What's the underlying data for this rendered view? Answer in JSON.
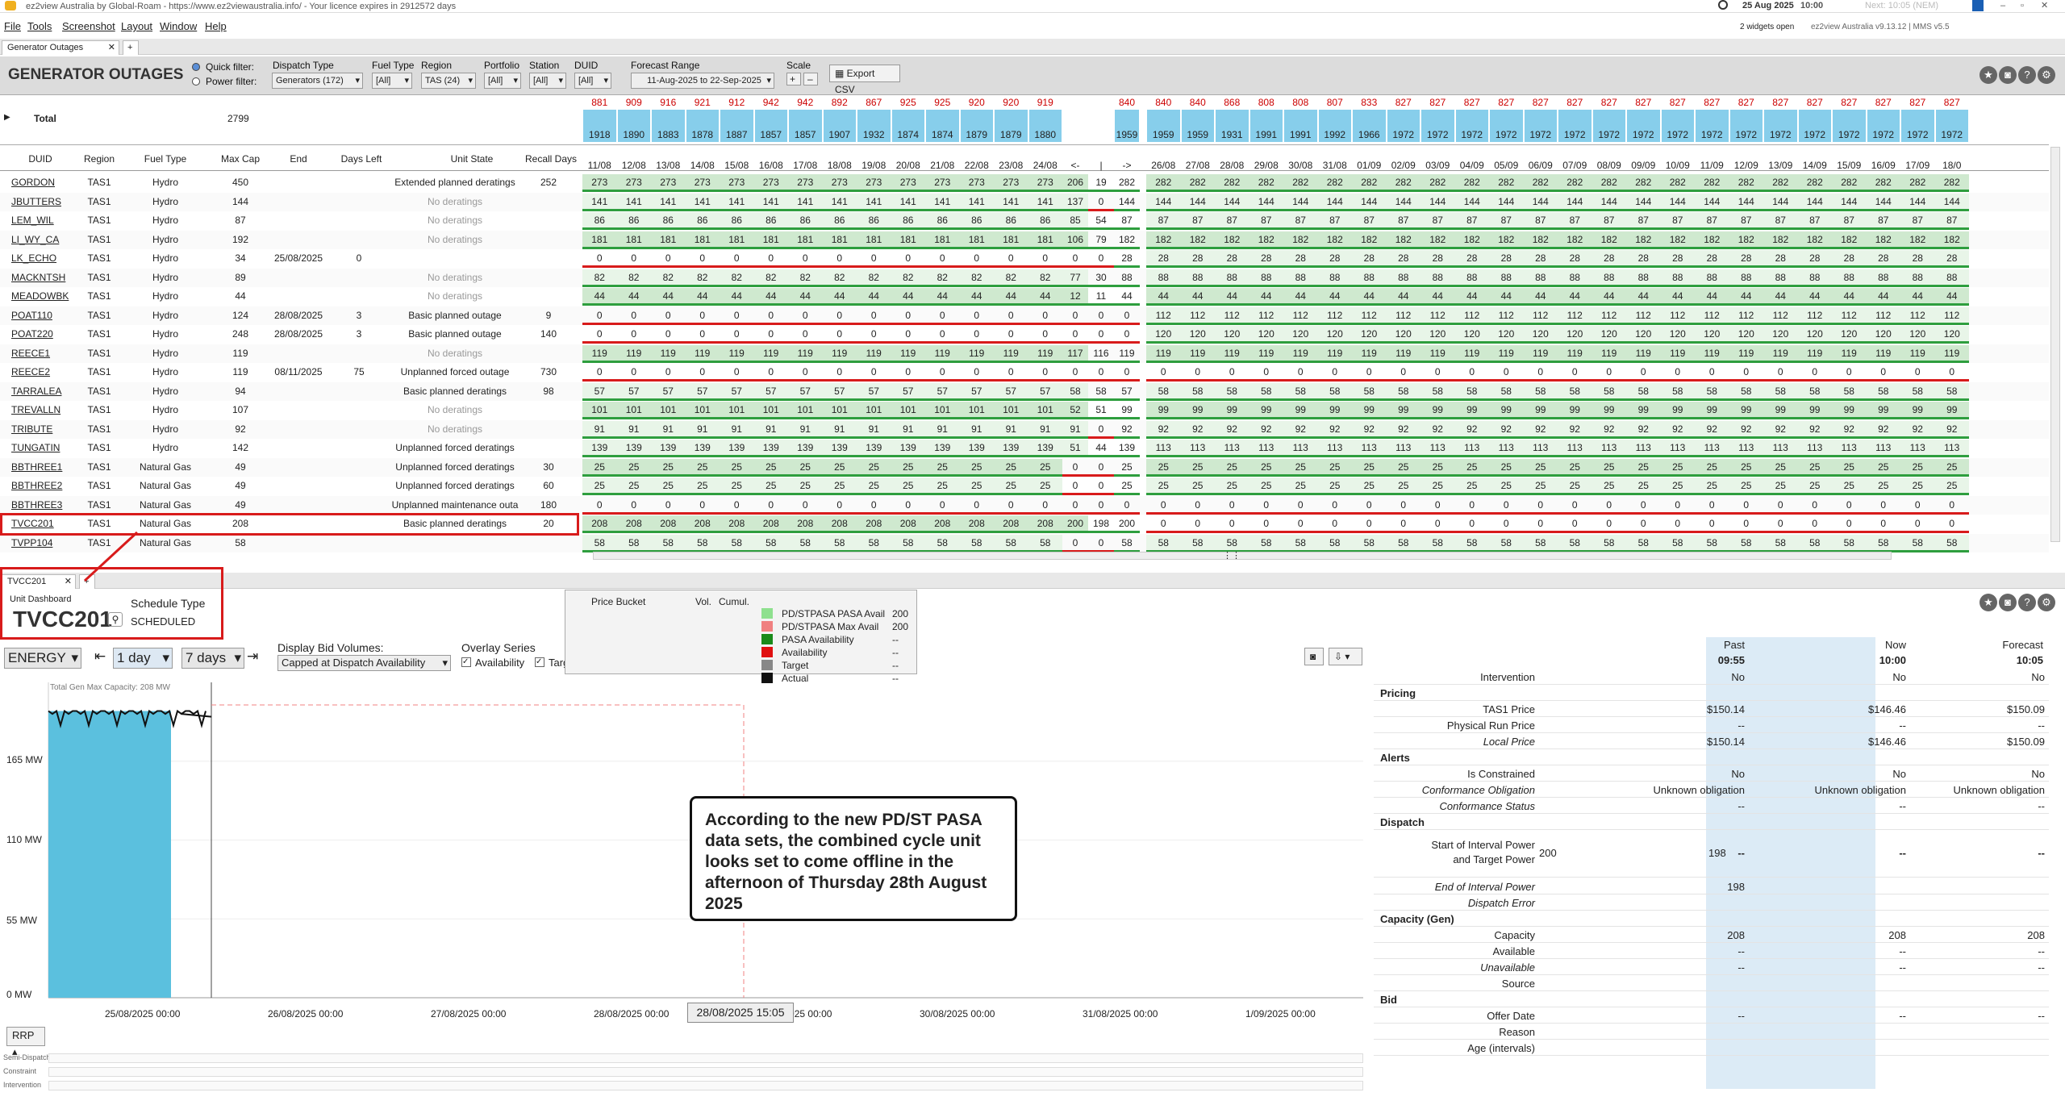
{
  "window": {
    "title": "ez2view Australia by Global-Roam - https://www.ez2viewaustralia.info/ - Your licence expires in 2912572 days",
    "date": "25 Aug 2025",
    "time": "10:00",
    "next": "Next: 10:05 (NEM)",
    "widgets_open": "2 widgets open",
    "version": "ez2view Australia v9.13.12 | MMS v5.5"
  },
  "menu": [
    "File",
    "Tools",
    "Screenshot",
    "Layout",
    "Window",
    "Help"
  ],
  "tabs": {
    "top": "Generator Outages",
    "add": "+",
    "lower": "TVCC201"
  },
  "toolbar": {
    "title": "GENERATOR OUTAGES",
    "quick_filter": "Quick filter:",
    "power_filter": "Power filter:",
    "dispatch_type_label": "Dispatch Type",
    "dispatch_type": "Generators (172)",
    "fuel_type_label": "Fuel Type",
    "fuel_type": "[All]",
    "region_label": "Region",
    "region": "TAS (24)",
    "portfolio_label": "Portfolio",
    "portfolio": "[All]",
    "station_label": "Station",
    "station": "[All]",
    "duid_label": "DUID",
    "duid": "[All]",
    "forecast_label": "Forecast Range",
    "forecast": "11-Aug-2025 to 22-Sep-2025",
    "scale_label": "Scale",
    "export": "Export CSV"
  },
  "total": {
    "label": "Total",
    "maxcap": "2799",
    "top": [
      "881",
      "909",
      "916",
      "921",
      "912",
      "942",
      "942",
      "892",
      "867",
      "925",
      "925",
      "920",
      "920",
      "919",
      "",
      "",
      "840",
      "840",
      "840",
      "868",
      "808",
      "808",
      "807",
      "833",
      "827",
      "827",
      "827",
      "827",
      "827",
      "827",
      "827",
      "827",
      "827",
      "827",
      "827",
      "827",
      "827",
      "827",
      "827",
      "827",
      "827",
      "827",
      "827"
    ],
    "bottom": [
      "1918",
      "1890",
      "1883",
      "1878",
      "1887",
      "1857",
      "1857",
      "1907",
      "1932",
      "1874",
      "1874",
      "1879",
      "1879",
      "1880",
      "",
      "",
      "1959",
      "1959",
      "1959",
      "1931",
      "1991",
      "1991",
      "1992",
      "1966",
      "1972",
      "1972",
      "1972",
      "1972",
      "1972",
      "1972",
      "1972",
      "1972",
      "1972",
      "1972",
      "1972",
      "1972",
      "1972",
      "1972",
      "1972",
      "1972",
      "1972",
      "1972",
      "1972"
    ]
  },
  "columns": {
    "duid": "DUID",
    "region": "Region",
    "fuel": "Fuel Type",
    "maxcap": "Max Cap",
    "end": "End",
    "daysleft": "Days Left",
    "state": "Unit State",
    "recall": "Recall Days"
  },
  "dates": [
    "11/08",
    "12/08",
    "13/08",
    "14/08",
    "15/08",
    "16/08",
    "17/08",
    "18/08",
    "19/08",
    "20/08",
    "21/08",
    "22/08",
    "23/08",
    "24/08",
    "<-",
    "|",
    "->",
    "26/08",
    "27/08",
    "28/08",
    "29/08",
    "30/08",
    "31/08",
    "01/09",
    "02/09",
    "03/09",
    "04/09",
    "05/09",
    "06/09",
    "07/09",
    "08/09",
    "09/09",
    "10/09",
    "11/09",
    "12/09",
    "13/09",
    "14/09",
    "15/09",
    "16/09",
    "17/09",
    "18/0"
  ],
  "rows": [
    {
      "duid": "GORDON",
      "region": "TAS1",
      "fuel": "Hydro",
      "maxcap": "450",
      "end": "",
      "daysleft": "",
      "state": "Extended planned deratings",
      "recall": "252",
      "past": "273",
      "mid": [
        "206",
        "19",
        "282"
      ],
      "fut": "282"
    },
    {
      "duid": "JBUTTERS",
      "region": "TAS1",
      "fuel": "Hydro",
      "maxcap": "144",
      "end": "",
      "daysleft": "",
      "state": "No deratings",
      "recall": "",
      "past": "141",
      "mid": [
        "137",
        "0",
        "144"
      ],
      "fut": "144"
    },
    {
      "duid": "LEM_WIL",
      "region": "TAS1",
      "fuel": "Hydro",
      "maxcap": "87",
      "end": "",
      "daysleft": "",
      "state": "No deratings",
      "recall": "",
      "past": "86",
      "mid": [
        "85",
        "54",
        "87"
      ],
      "fut": "87"
    },
    {
      "duid": "LI_WY_CA",
      "region": "TAS1",
      "fuel": "Hydro",
      "maxcap": "192",
      "end": "",
      "daysleft": "",
      "state": "No deratings",
      "recall": "",
      "past": "181",
      "mid": [
        "106",
        "79",
        "182"
      ],
      "fut": "182"
    },
    {
      "duid": "LK_ECHO",
      "region": "TAS1",
      "fuel": "Hydro",
      "maxcap": "34",
      "end": "25/08/2025",
      "daysleft": "0",
      "state": "",
      "recall": "",
      "past": "0",
      "mid": [
        "0",
        "0",
        "28"
      ],
      "fut": "28"
    },
    {
      "duid": "MACKNTSH",
      "region": "TAS1",
      "fuel": "Hydro",
      "maxcap": "89",
      "end": "",
      "daysleft": "",
      "state": "No deratings",
      "recall": "",
      "past": "82",
      "mid": [
        "77",
        "30",
        "88"
      ],
      "fut": "88"
    },
    {
      "duid": "MEADOWBK",
      "region": "TAS1",
      "fuel": "Hydro",
      "maxcap": "44",
      "end": "",
      "daysleft": "",
      "state": "No deratings",
      "recall": "",
      "past": "44",
      "mid": [
        "12",
        "11",
        "44"
      ],
      "fut": "44"
    },
    {
      "duid": "POAT110",
      "region": "TAS1",
      "fuel": "Hydro",
      "maxcap": "124",
      "end": "28/08/2025",
      "daysleft": "3",
      "state": "Basic planned outage",
      "recall": "9",
      "past": "0",
      "mid": [
        "0",
        "0",
        "0"
      ],
      "fut": "112"
    },
    {
      "duid": "POAT220",
      "region": "TAS1",
      "fuel": "Hydro",
      "maxcap": "248",
      "end": "28/08/2025",
      "daysleft": "3",
      "state": "Basic planned outage",
      "recall": "140",
      "past": "0",
      "mid": [
        "0",
        "0",
        "0"
      ],
      "fut": "120"
    },
    {
      "duid": "REECE1",
      "region": "TAS1",
      "fuel": "Hydro",
      "maxcap": "119",
      "end": "",
      "daysleft": "",
      "state": "No deratings",
      "recall": "",
      "past": "119",
      "mid": [
        "117",
        "116",
        "119"
      ],
      "fut": "119"
    },
    {
      "duid": "REECE2",
      "region": "TAS1",
      "fuel": "Hydro",
      "maxcap": "119",
      "end": "08/11/2025",
      "daysleft": "75",
      "state": "Unplanned forced outage",
      "recall": "730",
      "past": "0",
      "mid": [
        "0",
        "0",
        "0"
      ],
      "fut": "0"
    },
    {
      "duid": "TARRALEA",
      "region": "TAS1",
      "fuel": "Hydro",
      "maxcap": "94",
      "end": "",
      "daysleft": "",
      "state": "Basic planned deratings",
      "recall": "98",
      "past": "57",
      "mid": [
        "58",
        "58",
        "57"
      ],
      "fut": "58"
    },
    {
      "duid": "TREVALLN",
      "region": "TAS1",
      "fuel": "Hydro",
      "maxcap": "107",
      "end": "",
      "daysleft": "",
      "state": "No deratings",
      "recall": "",
      "past": "101",
      "mid": [
        "52",
        "51",
        "99"
      ],
      "fut": "99"
    },
    {
      "duid": "TRIBUTE",
      "region": "TAS1",
      "fuel": "Hydro",
      "maxcap": "92",
      "end": "",
      "daysleft": "",
      "state": "No deratings",
      "recall": "",
      "past": "91",
      "mid": [
        "91",
        "0",
        "92"
      ],
      "fut": "92"
    },
    {
      "duid": "TUNGATIN",
      "region": "TAS1",
      "fuel": "Hydro",
      "maxcap": "142",
      "end": "",
      "daysleft": "",
      "state": "Unplanned forced deratings",
      "recall": "",
      "past": "139",
      "mid": [
        "51",
        "44",
        "139"
      ],
      "fut": "113"
    },
    {
      "duid": "BBTHREE1",
      "region": "TAS1",
      "fuel": "Natural Gas",
      "maxcap": "49",
      "end": "",
      "daysleft": "",
      "state": "Unplanned forced deratings",
      "recall": "30",
      "past": "25",
      "mid": [
        "0",
        "0",
        "25"
      ],
      "fut": "25"
    },
    {
      "duid": "BBTHREE2",
      "region": "TAS1",
      "fuel": "Natural Gas",
      "maxcap": "49",
      "end": "",
      "daysleft": "",
      "state": "Unplanned forced deratings",
      "recall": "60",
      "past": "25",
      "mid": [
        "0",
        "0",
        "25"
      ],
      "fut": "25"
    },
    {
      "duid": "BBTHREE3",
      "region": "TAS1",
      "fuel": "Natural Gas",
      "maxcap": "49",
      "end": "",
      "daysleft": "",
      "state": "Unplanned maintenance outa",
      "recall": "180",
      "past": "0",
      "mid": [
        "0",
        "0",
        "0"
      ],
      "fut": "0"
    },
    {
      "duid": "TVCC201",
      "region": "TAS1",
      "fuel": "Natural Gas",
      "maxcap": "208",
      "end": "",
      "daysleft": "",
      "state": "Basic planned deratings",
      "recall": "20",
      "past": "208",
      "mid": [
        "200",
        "198",
        "200"
      ],
      "fut": "0"
    },
    {
      "duid": "TVPP104",
      "region": "TAS1",
      "fuel": "Natural Gas",
      "maxcap": "58",
      "end": "",
      "daysleft": "",
      "state": "",
      "recall": "",
      "past": "58",
      "mid": [
        "0",
        "0",
        "58"
      ],
      "fut": "58"
    }
  ],
  "unit": {
    "dash": "Unit Dashboard",
    "name": "TVCC201",
    "sched_label": "Schedule Type",
    "sched": "SCHEDULED",
    "energy": "ENERGY",
    "day": "1 day",
    "days7": "7 days",
    "bid_label": "Display Bid Volumes:",
    "bid": "Capped at Dispatch Availability",
    "overlay": "Overlay Series",
    "avail": "Availability",
    "targ": "Targ",
    "rrp": "RRP",
    "chart_cap": "Total Gen Max Capacity: 208 MW",
    "hover": "28/08/2025 15:05"
  },
  "legend": {
    "price_bucket": "Price Bucket",
    "vol": "Vol.",
    "cumul": "Cumul.",
    "items": [
      {
        "name": "PD/STPASA PASA Avail",
        "val": "200",
        "color": "#8ee08e"
      },
      {
        "name": "PD/STPASA Max Avail",
        "val": "200",
        "color": "#f08080"
      },
      {
        "name": "PASA Availability",
        "val": "--",
        "color": "#1a8a1a"
      },
      {
        "name": "Availability",
        "val": "--",
        "color": "#e01010"
      },
      {
        "name": "Target",
        "val": "--",
        "color": "#888888"
      },
      {
        "name": "Actual",
        "val": "--",
        "color": "#111111"
      }
    ]
  },
  "chart_data": {
    "type": "area",
    "yticks": [
      "165 MW",
      "110 MW",
      "55 MW",
      "0 MW"
    ],
    "xticks": [
      "25/08/2025 00:00",
      "26/08/2025 00:00",
      "27/08/2025 00:00",
      "28/08/2025 00:00",
      "29/08/2025 00:00",
      "30/08/2025 00:00",
      "31/08/2025 00:00",
      "1/09/2025 00:00"
    ],
    "ylim": [
      0,
      220
    ],
    "series": [
      {
        "values_mw": [
          200,
          198,
          200,
          196,
          200,
          198,
          200
        ]
      }
    ]
  },
  "table": {
    "cols": [
      "Past",
      "Now",
      "Forecast"
    ],
    "times": [
      "09:55",
      "10:00",
      "10:05"
    ],
    "rows": [
      {
        "k": "Intervention",
        "a": "No",
        "b": "No",
        "c": "No"
      },
      {
        "k": "Pricing",
        "sec": true
      },
      {
        "k": "TAS1 Price",
        "a": "$150.14",
        "b": "$146.46",
        "c": "$150.09"
      },
      {
        "k": "Physical Run Price",
        "a": "--",
        "b": "--",
        "c": "--"
      },
      {
        "k": "Local Price",
        "a": "$150.14",
        "b": "$146.46",
        "c": "$150.09",
        "it": true
      },
      {
        "k": "Alerts",
        "sec": true
      },
      {
        "k": "Is Constrained",
        "a": "No",
        "b": "No",
        "c": "No"
      },
      {
        "k": "Conformance Obligation",
        "a": "Unknown obligation",
        "b": "Unknown obligation",
        "c": "Unknown obligation",
        "it": true
      },
      {
        "k": "Conformance Status",
        "a": "--",
        "b": "--",
        "c": "--",
        "it": true
      },
      {
        "k": "Dispatch",
        "sec": true
      }
    ],
    "start_label": "Start of Interval Power",
    "target_label": "and Target Power",
    "start_a": "200",
    "start_b": "198",
    "dash": "--",
    "rows2": [
      {
        "k": "End of Interval Power",
        "a": "198",
        "b": "",
        "c": "",
        "it": true
      },
      {
        "k": "Dispatch Error",
        "a": "",
        "b": "",
        "c": "",
        "it": true
      },
      {
        "k": "Capacity (Gen)",
        "sec": true
      },
      {
        "k": "Capacity",
        "a": "208",
        "b": "208",
        "c": "208"
      },
      {
        "k": "Available",
        "a": "--",
        "b": "--",
        "c": "--"
      },
      {
        "k": "Unavailable",
        "a": "--",
        "b": "--",
        "c": "--",
        "it": true
      },
      {
        "k": "Source",
        "a": "",
        "b": "",
        "c": ""
      },
      {
        "k": "Bid",
        "sec": true
      },
      {
        "k": "Offer Date",
        "a": "--",
        "b": "--",
        "c": "--"
      },
      {
        "k": "Reason",
        "a": "",
        "b": "",
        "c": ""
      },
      {
        "k": "Age (intervals)",
        "a": "",
        "b": "",
        "c": ""
      }
    ]
  },
  "bottom_rows": [
    "Semi-Dispatch Cap",
    "Constraint",
    "Intervention"
  ],
  "callout": "According to the new PD/ST PASA data sets, the combined cycle unit looks set to come offline in the afternoon of Thursday 28th August 2025"
}
